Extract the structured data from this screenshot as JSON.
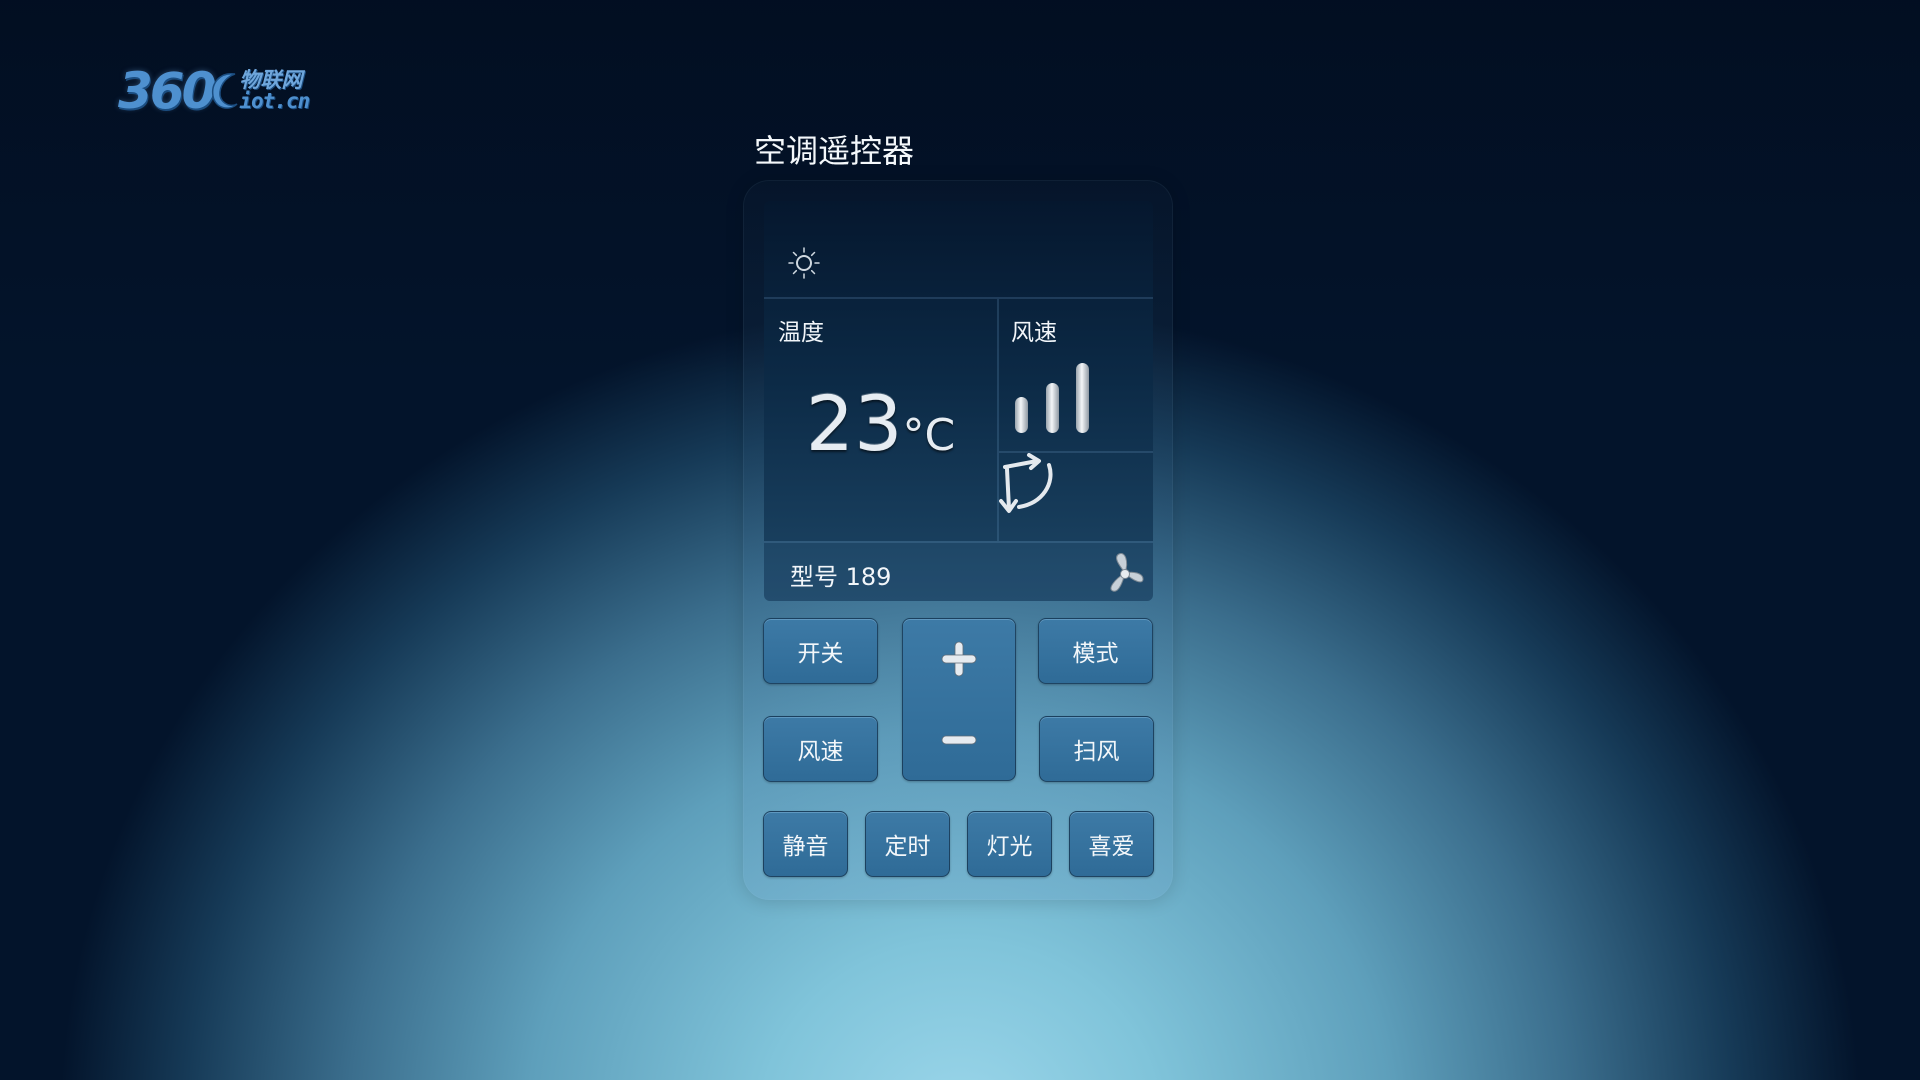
{
  "logo": {
    "number": "360",
    "cn": "物联网",
    "domain": "iot.cn"
  },
  "title": "空调遥控器",
  "display": {
    "mode_icon": "sun-icon",
    "temperature_label": "温度",
    "temperature_value": "23",
    "temperature_unit": "°C",
    "fan_speed_label": "风速",
    "fan_speed_level": {
      "bars_filled": 3,
      "bars_total": 3
    },
    "swing_icon": "swing-arrow-icon",
    "model_text": "型号 189",
    "fan_icon": "fan-icon"
  },
  "buttons": {
    "power": "开关",
    "mode": "模式",
    "fan_speed": "风速",
    "swing": "扫风",
    "temp_up": "+",
    "temp_down": "−",
    "mute": "静音",
    "timer": "定时",
    "light": "灯光",
    "favorite": "喜爱"
  },
  "colors": {
    "button": "#3a76a2",
    "display_top": "#05172e",
    "display_bottom": "#1d4666",
    "logo_blue": "#4e90cf"
  }
}
